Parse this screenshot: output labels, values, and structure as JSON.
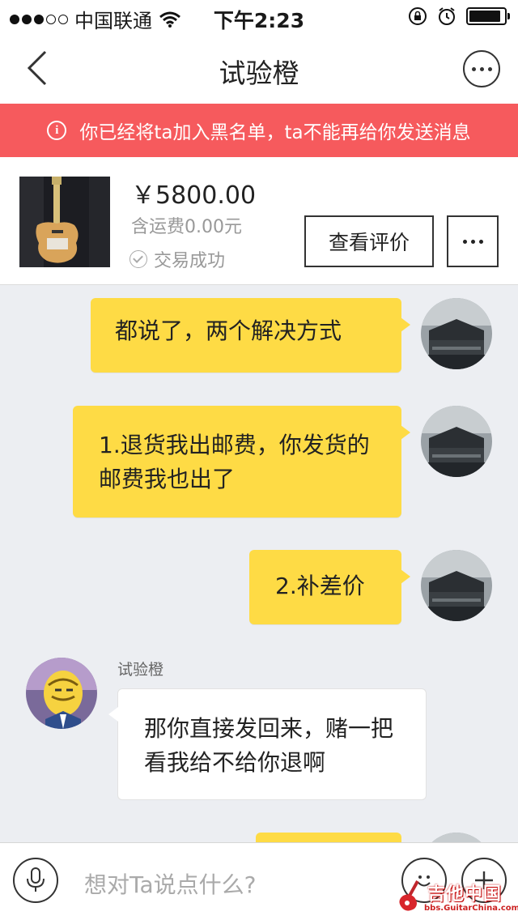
{
  "status_bar": {
    "carrier": "中国联通",
    "time": "下午2:23",
    "signal_strength": 3,
    "battery_level": 0.9
  },
  "nav": {
    "title": "试验橙"
  },
  "banner": {
    "text": "你已经将ta加入黑名单，ta不能再给你发送消息",
    "color": "#f65a5d"
  },
  "product": {
    "price": "￥5800.00",
    "shipping": "含运费0.00元",
    "status": "交易成功",
    "review_button": "查看评价"
  },
  "messages": [
    {
      "from": "me",
      "text": "都说了，两个解决方式"
    },
    {
      "from": "me",
      "text": "1.退货我出邮费，你发货的邮费我也出了"
    },
    {
      "from": "me",
      "text": "2.补差价"
    },
    {
      "from": "them",
      "sender": "试验橙",
      "text": "那你直接发回来，赌一把看我给不给你退啊"
    },
    {
      "from": "me",
      "text": ""
    }
  ],
  "input": {
    "placeholder": "想对Ta说点什么?"
  },
  "watermark": {
    "title": "吉他中国",
    "url": "bbs.GuitarChina.com"
  },
  "colors": {
    "my_bubble": "#fedb45",
    "their_bubble": "#ffffff",
    "chat_background": "#eceef2"
  }
}
